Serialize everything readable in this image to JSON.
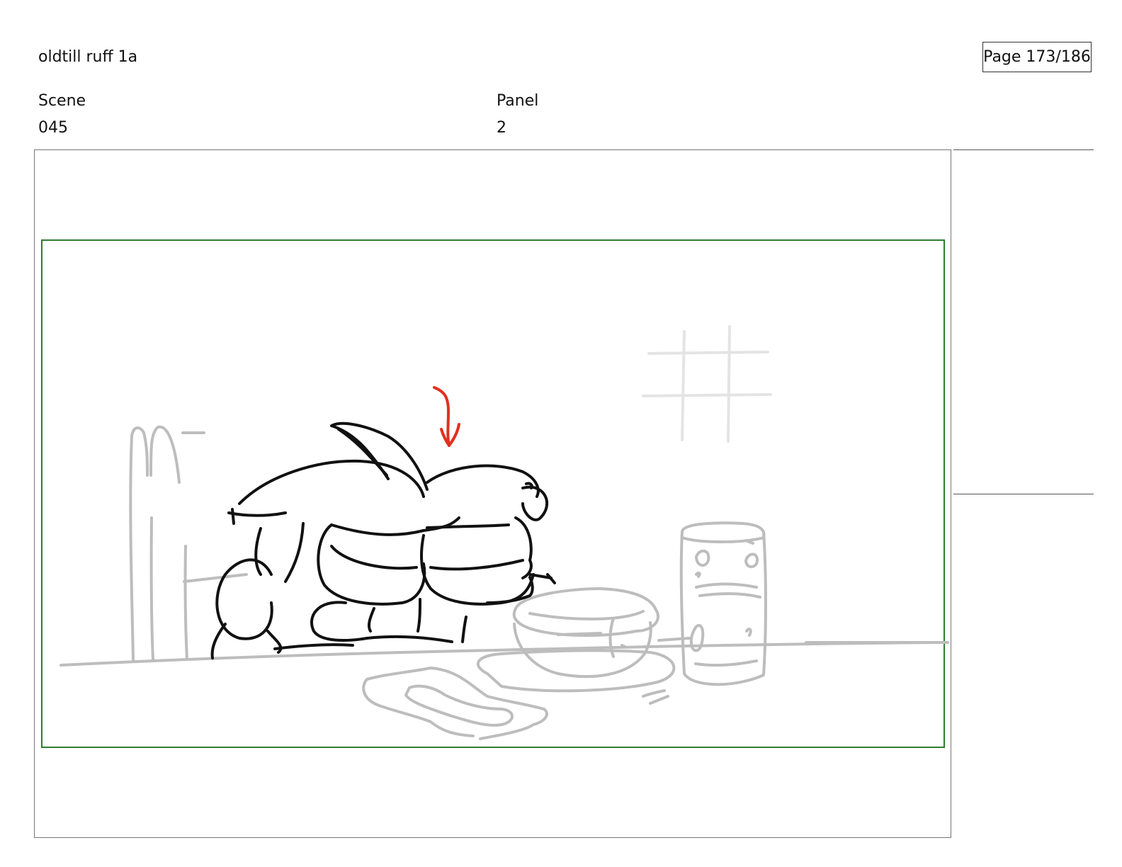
{
  "document": {
    "title": "oldtill ruff 1a",
    "page": "Page 173/186"
  },
  "fields": {
    "scene_label": "Scene",
    "scene_value": "045",
    "panel_label": "Panel",
    "panel_value": "2"
  },
  "colors": {
    "safe_frame": "#2e7d32",
    "ink": "#111111",
    "background_sketch": "#bdbdbd",
    "direction_arrow": "#e0301e"
  },
  "icons": {
    "direction_arrow": "red-down-arrow-icon"
  }
}
